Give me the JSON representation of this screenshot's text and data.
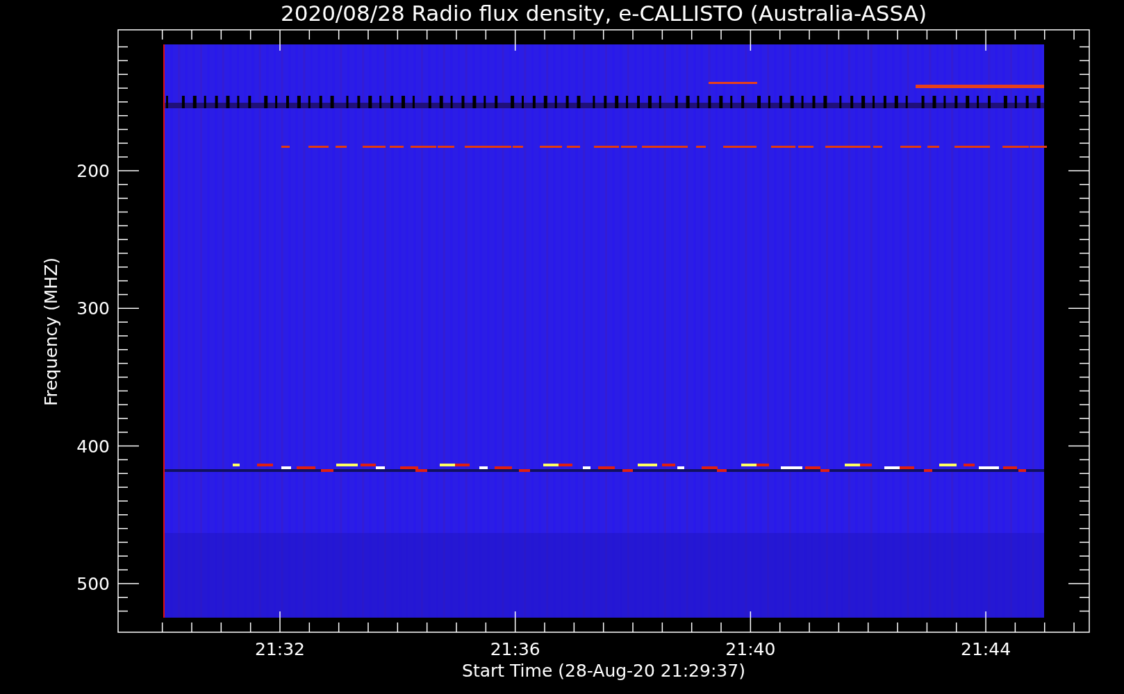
{
  "title": "2020/08/28  Radio flux density, e-CALLISTO (Australia-ASSA)",
  "y_axis": {
    "label": "Frequency (MHZ)",
    "ticks": [
      "200",
      "300",
      "400",
      "500"
    ]
  },
  "x_axis": {
    "label": "Start Time (28-Aug-20 21:29:37)",
    "ticks": [
      "21:32",
      "21:36",
      "21:40",
      "21:44"
    ]
  }
}
